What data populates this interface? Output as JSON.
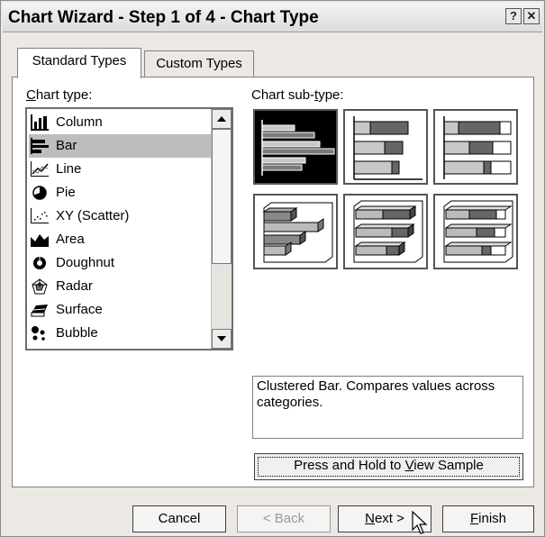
{
  "window": {
    "title": "Chart Wizard - Step 1 of 4 - Chart Type",
    "help_glyph": "?",
    "close_glyph": "✕"
  },
  "tabs": [
    {
      "label": "Standard Types",
      "active": true
    },
    {
      "label": "Custom Types",
      "active": false
    }
  ],
  "chart_type": {
    "label_first": "C",
    "label_rest": "hart type:",
    "items": [
      {
        "label": "Column",
        "icon": "column-chart-icon",
        "selected": false
      },
      {
        "label": "Bar",
        "icon": "bar-chart-icon",
        "selected": true
      },
      {
        "label": "Line",
        "icon": "line-chart-icon",
        "selected": false
      },
      {
        "label": "Pie",
        "icon": "pie-chart-icon",
        "selected": false
      },
      {
        "label": "XY (Scatter)",
        "icon": "scatter-chart-icon",
        "selected": false
      },
      {
        "label": "Area",
        "icon": "area-chart-icon",
        "selected": false
      },
      {
        "label": "Doughnut",
        "icon": "doughnut-chart-icon",
        "selected": false
      },
      {
        "label": "Radar",
        "icon": "radar-chart-icon",
        "selected": false
      },
      {
        "label": "Surface",
        "icon": "surface-chart-icon",
        "selected": false
      },
      {
        "label": "Bubble",
        "icon": "bubble-chart-icon",
        "selected": false
      }
    ]
  },
  "sub_type": {
    "label_a": "Chart sub-",
    "label_u": "t",
    "label_b": "ype:"
  },
  "description": "Clustered Bar. Compares values across categories.",
  "sample_button": {
    "label_a": "Press and Hold to ",
    "label_u": "V",
    "label_b": "iew Sample"
  },
  "buttons": {
    "cancel": "Cancel",
    "back": "< Back",
    "next_u": "N",
    "next_rest": "ext >",
    "finish_u": "F",
    "finish_rest": "inish"
  }
}
